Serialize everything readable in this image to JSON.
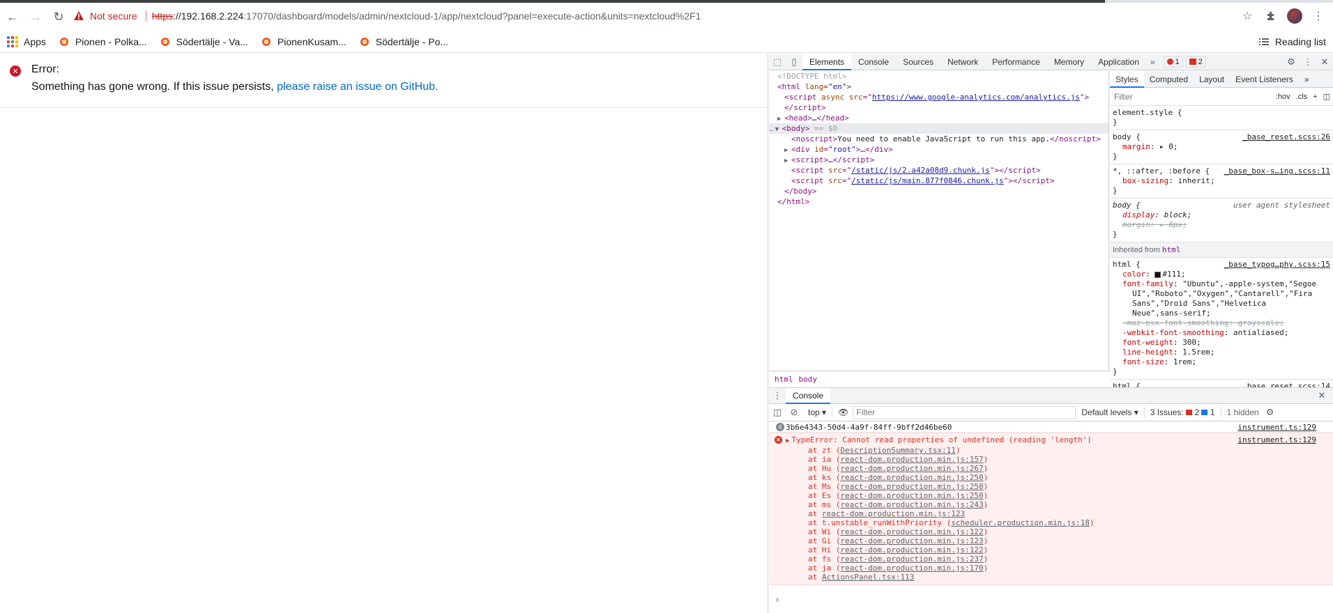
{
  "browser": {
    "url": {
      "warning": "Not secure",
      "scheme": "https",
      "host": "://192.168.2.224",
      "rest": ":17070/dashboard/models/admin/nextcloud-1/app/nextcloud?panel=execute-action&units=nextcloud%2F1"
    },
    "bookmarks": [
      {
        "label": "Apps"
      },
      {
        "label": "Pionen - Polka..."
      },
      {
        "label": "Södertälje - Va..."
      },
      {
        "label": "PionenKusam..."
      },
      {
        "label": "Södertälje - Po..."
      }
    ],
    "reading_list": "Reading list"
  },
  "page": {
    "error_title": "Error:",
    "error_msg": "Something has gone wrong. If this issue persists, ",
    "error_link": "please raise an issue on GitHub."
  },
  "devtools": {
    "tabs": [
      "Elements",
      "Console",
      "Sources",
      "Network",
      "Performance",
      "Memory",
      "Application"
    ],
    "error_count": "1",
    "issue_count": "2",
    "elements": {
      "doctype": "<!DOCTYPE html>",
      "html_open": "html",
      "lang_attr": "lang",
      "lang_val": "\"en\"",
      "script1_attr": "async src",
      "script1_src": "https://www.google-analytics.com/analytics.js",
      "head": "head",
      "body": "body",
      "body_marker": " == $0",
      "noscript_text": "You need to enable JavaScript to run this app.",
      "div_id": "\"root\"",
      "chunk1": "/static/js/2.a42a08d9.chunk.js",
      "chunk2": "/static/js/main.877f0846.chunk.js",
      "ellipsis": "…"
    },
    "breadcrumbs": [
      "html",
      "body"
    ],
    "styles_tabs": [
      "Styles",
      "Computed",
      "Layout",
      "Event Listeners"
    ],
    "styles_filter_placeholder": "Filter",
    "hov": ":hov",
    "cls": ".cls",
    "rules": {
      "element_style": "element.style {",
      "body_sel": "body {",
      "body_src": "_base_reset.scss:26",
      "margin_prop": "margin",
      "margin_val": "0;",
      "universal_sel": "*, ::after, :before {",
      "universal_src": "_base_box-s…ing.scss:11",
      "boxsizing_prop": "box-sizing",
      "boxsizing_val": "inherit;",
      "ua_body_sel": "body {",
      "ua_label": "user agent stylesheet",
      "display_prop": "display",
      "display_val": "block;",
      "ua_margin_prop": "margin",
      "ua_margin_val": "8px;",
      "inherited_label": "Inherited from ",
      "inherited_tag": "html",
      "html_sel": "html {",
      "html_src": "_base_typog…phy.scss:15",
      "color_prop": "color",
      "color_val": "#111;",
      "ff_prop": "font-family",
      "ff_val1": "\"Ubuntu\",-apple-system,\"Segoe",
      "ff_val2": "UI\",\"Roboto\",\"Oxygen\",\"Cantarell\",\"Fira",
      "ff_val3": "Sans\",\"Droid Sans\",\"Helvetica",
      "ff_val4": "Neue\",sans-serif;",
      "moz_prop": "-moz-osx-font-smoothing: grayscale;",
      "webkit_prop": "-webkit-font-smoothing",
      "webkit_val": "antialiased;",
      "fw_prop": "font-weight",
      "fw_val": "300;",
      "lh_prop": "line-height",
      "lh_val": "1.5rem;",
      "fs_prop": "font-size",
      "fs_val": "1rem;",
      "next_sel": "html {",
      "next_src": "_base_reset.scss:14",
      "close": "}"
    },
    "drawer_tab": "Console",
    "console_toolbar": {
      "context": "top",
      "filter_placeholder": "Filter",
      "levels": "Default levels",
      "issues_label": "3 Issues:",
      "issues_red": "2",
      "issues_blue": "1",
      "hidden": "1 hidden"
    },
    "console": {
      "log_count": "4",
      "log_text": "3b6e4343-50d4-4a9f-84ff-9bff2d46be60",
      "log_src": "instrument.ts:129",
      "error_text": "TypeError: Cannot read properties of undefined (reading 'length')",
      "error_src": "instrument.ts:129",
      "frames": [
        {
          "fn": "at zt (",
          "loc": "DescriptionSummary.tsx:11",
          "end": ")"
        },
        {
          "fn": "at ia (",
          "loc": "react-dom.production.min.js:157",
          "end": ")"
        },
        {
          "fn": "at Hu (",
          "loc": "react-dom.production.min.js:267",
          "end": ")"
        },
        {
          "fn": "at ks (",
          "loc": "react-dom.production.min.js:250",
          "end": ")"
        },
        {
          "fn": "at Ms (",
          "loc": "react-dom.production.min.js:250",
          "end": ")"
        },
        {
          "fn": "at Es (",
          "loc": "react-dom.production.min.js:250",
          "end": ")"
        },
        {
          "fn": "at ms (",
          "loc": "react-dom.production.min.js:243",
          "end": ")"
        },
        {
          "fn": "at ",
          "loc": "react-dom.production.min.js:123",
          "end": ""
        },
        {
          "fn": "at t.unstable_runWithPriority (",
          "loc": "scheduler.production.min.js:18",
          "end": ")"
        },
        {
          "fn": "at Wi (",
          "loc": "react-dom.production.min.js:122",
          "end": ")"
        },
        {
          "fn": "at Gi (",
          "loc": "react-dom.production.min.js:123",
          "end": ")"
        },
        {
          "fn": "at Hi (",
          "loc": "react-dom.production.min.js:122",
          "end": ")"
        },
        {
          "fn": "at fs (",
          "loc": "react-dom.production.min.js:237",
          "end": ")"
        },
        {
          "fn": "at ja (",
          "loc": "react-dom.production.min.js:170",
          "end": ")"
        },
        {
          "fn": "at ",
          "loc": "ActionsPanel.tsx:113",
          "end": ""
        }
      ],
      "prompt": "›"
    }
  }
}
